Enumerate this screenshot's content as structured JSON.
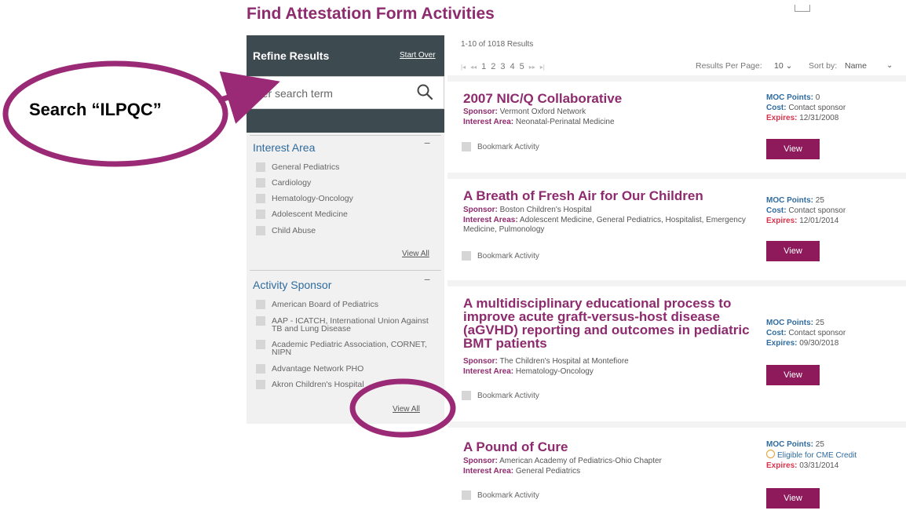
{
  "page": {
    "title": "Find Attestation Form Activities"
  },
  "sidebar": {
    "header": "Refine Results",
    "start_over": "Start Over",
    "search": {
      "placeholder": "nter search term",
      "value": ""
    },
    "interest_area": {
      "title": "Interest Area",
      "collapse": "−",
      "items": [
        "General Pediatrics",
        "Cardiology",
        "Hematology-Oncology",
        "Adolescent Medicine",
        "Child Abuse"
      ],
      "view_all": "View All"
    },
    "activity_sponsor": {
      "title": "Activity Sponsor",
      "collapse": "−",
      "items": [
        "American Board of Pediatrics",
        "AAP - ICATCH, International Union Against TB and Lung Disease",
        "Academic Pediatric Association, CORNET, NIPN",
        "Advantage Network PHO",
        "Akron Children's Hospital"
      ],
      "view_all": "View All"
    }
  },
  "results": {
    "count": "1-10 of 1018 Results",
    "pages": [
      "1",
      "2",
      "3",
      "4",
      "5"
    ],
    "nav": {
      "first": "|◂",
      "prev": "◂◂",
      "next": "▸▸",
      "last": "▸|"
    },
    "per_page_label": "Results Per Page:",
    "per_page_value": "10 ⌄",
    "sort_label": "Sort by:",
    "sort_value": "Name",
    "sort_chevron": "⌄"
  },
  "activities": [
    {
      "title": "2007 NIC/Q Collaborative",
      "sponsor_label": "Sponsor:",
      "sponsor": "Vermont Oxford Network",
      "interest_label": "Interest Area:",
      "interest": "Neonatal-Perinatal Medicine",
      "bookmark": "Bookmark Activity",
      "moc_label": "MOC Points:",
      "moc": "0",
      "cost_label": "Cost:",
      "cost": "Contact sponsor",
      "expires_label": "Expires:",
      "expires": "12/31/2008",
      "view": "View"
    },
    {
      "title": "A Breath of Fresh Air for Our Children",
      "sponsor_label": "Sponsor:",
      "sponsor": "Boston Children's Hospital",
      "interest_label": "Interest Areas:",
      "interest": "Adolescent Medicine, General Pediatrics, Hospitalist, Emergency Medicine, Pulmonology",
      "bookmark": "Bookmark Activity",
      "moc_label": "MOC Points:",
      "moc": "25",
      "cost_label": "Cost:",
      "cost": "Contact sponsor",
      "expires_label": "Expires:",
      "expires": "12/01/2014",
      "view": "View"
    },
    {
      "title": "A multidisciplinary educational process to improve acute graft-versus-host disease (aGVHD) reporting and outcomes in pediatric BMT patients",
      "sponsor_label": "Sponsor:",
      "sponsor": "The Children's Hospital at Montefiore",
      "interest_label": "Interest Area:",
      "interest": "Hematology-Oncology",
      "bookmark": "Bookmark Activity",
      "moc_label": "MOC Points:",
      "moc": "25",
      "cost_label": "Cost:",
      "cost": "Contact sponsor",
      "expires_label": "Expires:",
      "expires": "09/30/2018",
      "view": "View"
    },
    {
      "title": "A Pound of Cure",
      "sponsor_label": "Sponsor:",
      "sponsor": "American Academy of Pediatrics-Ohio Chapter",
      "interest_label": "Interest Area:",
      "interest": "General Pediatrics",
      "bookmark": "Bookmark Activity",
      "moc_label": "MOC Points:",
      "moc": "25",
      "cme": "Eligible for CME Credit",
      "expires_label": "Expires:",
      "expires": "03/31/2014",
      "view": "View"
    }
  ],
  "annotation": {
    "callout": "Search “ILPQC”",
    "color": "#9b2a76"
  }
}
